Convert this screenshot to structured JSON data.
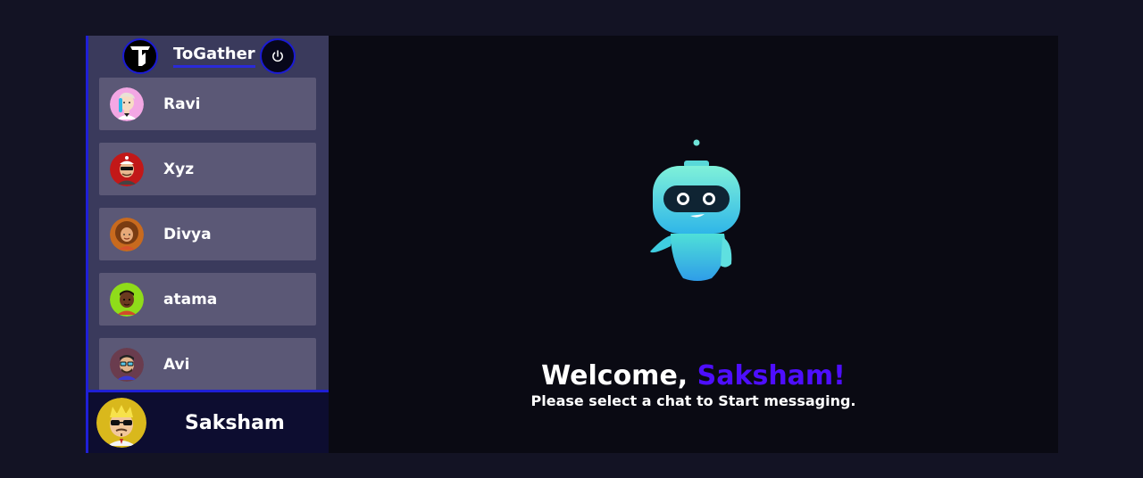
{
  "app": {
    "title": "ToGather"
  },
  "contacts": [
    {
      "name": "Ravi"
    },
    {
      "name": "Xyz"
    },
    {
      "name": "Divya"
    },
    {
      "name": "atama"
    },
    {
      "name": "Avi"
    }
  ],
  "current_user": {
    "name": "Saksham"
  },
  "welcome": {
    "greeting": "Welcome,",
    "username": "Saksham!",
    "subtitle": "Please select a chat to Start messaging."
  },
  "colors": {
    "accent": "#4e0eff",
    "sidebar_bg": "#3a3a5c",
    "contact_bg": "#5b5876",
    "border": "#1f1fd6",
    "main_bg": "#0a0a13",
    "page_bg": "#131324"
  },
  "icons": {
    "logo": "togather-logo-icon",
    "logout": "power-icon"
  }
}
